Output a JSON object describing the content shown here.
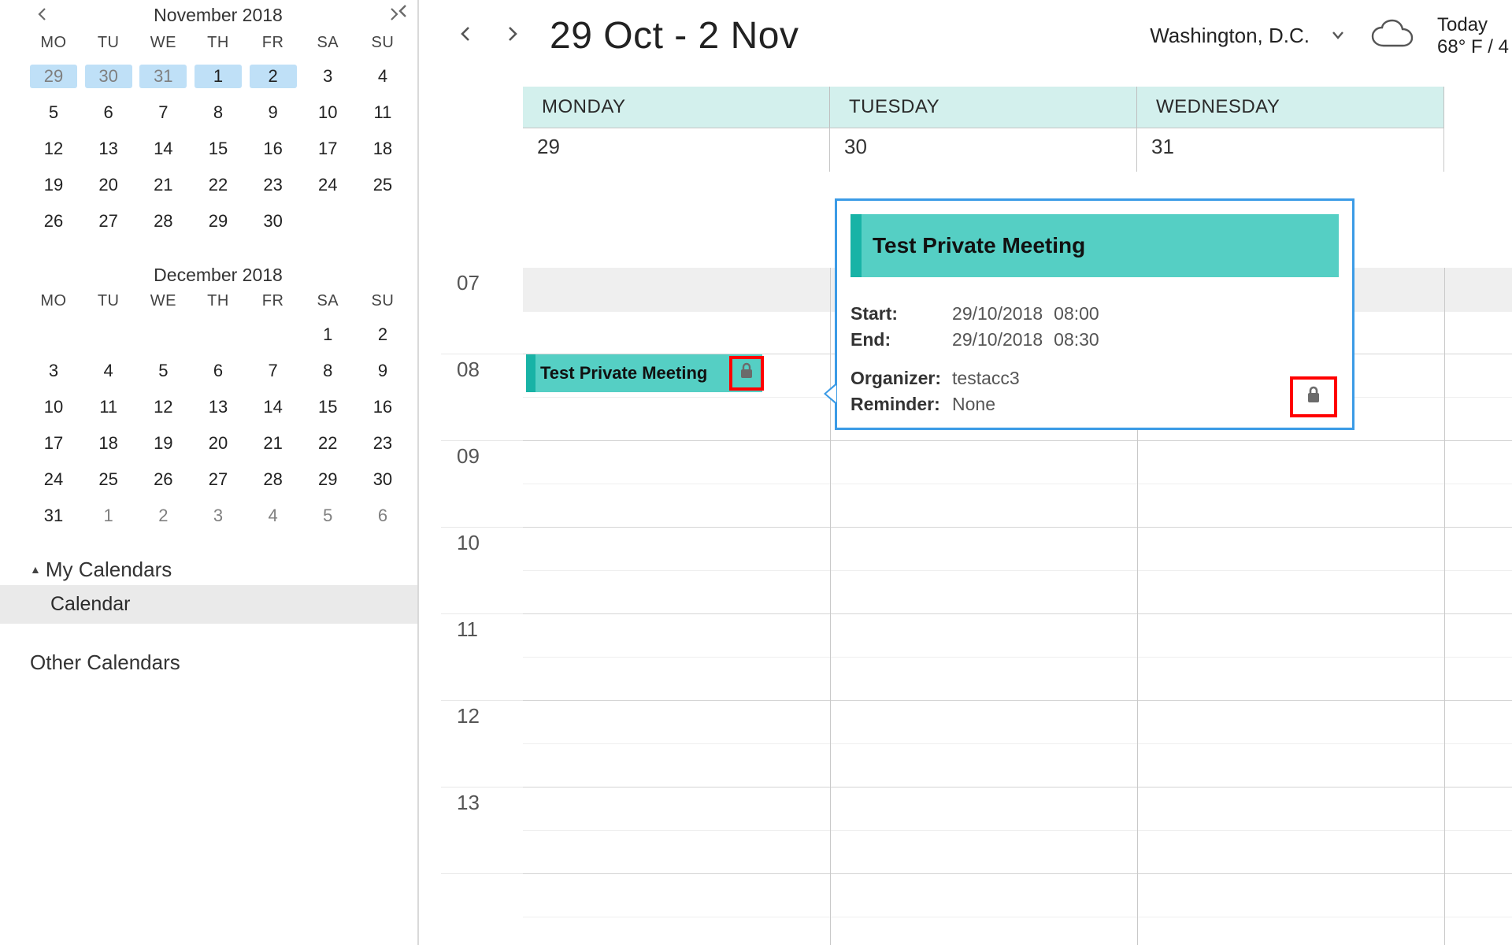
{
  "sidebar": {
    "month1": {
      "title": "November 2018",
      "dows": [
        "MO",
        "TU",
        "WE",
        "TH",
        "FR",
        "SA",
        "SU"
      ],
      "rows": [
        [
          {
            "n": "29",
            "sel": true,
            "dim": true
          },
          {
            "n": "30",
            "sel": true,
            "dim": true
          },
          {
            "n": "31",
            "sel": true,
            "dim": true
          },
          {
            "n": "1",
            "sel": true
          },
          {
            "n": "2",
            "sel": true
          },
          {
            "n": "3"
          },
          {
            "n": "4"
          }
        ],
        [
          {
            "n": "5"
          },
          {
            "n": "6"
          },
          {
            "n": "7"
          },
          {
            "n": "8"
          },
          {
            "n": "9"
          },
          {
            "n": "10"
          },
          {
            "n": "11"
          }
        ],
        [
          {
            "n": "12"
          },
          {
            "n": "13"
          },
          {
            "n": "14"
          },
          {
            "n": "15"
          },
          {
            "n": "16"
          },
          {
            "n": "17"
          },
          {
            "n": "18"
          }
        ],
        [
          {
            "n": "19"
          },
          {
            "n": "20"
          },
          {
            "n": "21"
          },
          {
            "n": "22"
          },
          {
            "n": "23"
          },
          {
            "n": "24"
          },
          {
            "n": "25"
          }
        ],
        [
          {
            "n": "26"
          },
          {
            "n": "27"
          },
          {
            "n": "28"
          },
          {
            "n": "29"
          },
          {
            "n": "30"
          },
          {
            "n": ""
          },
          {
            "n": ""
          }
        ]
      ]
    },
    "month2": {
      "title": "December 2018",
      "dows": [
        "MO",
        "TU",
        "WE",
        "TH",
        "FR",
        "SA",
        "SU"
      ],
      "rows": [
        [
          {
            "n": ""
          },
          {
            "n": ""
          },
          {
            "n": ""
          },
          {
            "n": ""
          },
          {
            "n": ""
          },
          {
            "n": "1"
          },
          {
            "n": "2"
          }
        ],
        [
          {
            "n": "3"
          },
          {
            "n": "4"
          },
          {
            "n": "5"
          },
          {
            "n": "6"
          },
          {
            "n": "7"
          },
          {
            "n": "8"
          },
          {
            "n": "9"
          }
        ],
        [
          {
            "n": "10"
          },
          {
            "n": "11"
          },
          {
            "n": "12"
          },
          {
            "n": "13"
          },
          {
            "n": "14"
          },
          {
            "n": "15"
          },
          {
            "n": "16"
          }
        ],
        [
          {
            "n": "17"
          },
          {
            "n": "18"
          },
          {
            "n": "19"
          },
          {
            "n": "20"
          },
          {
            "n": "21"
          },
          {
            "n": "22"
          },
          {
            "n": "23"
          }
        ],
        [
          {
            "n": "24"
          },
          {
            "n": "25"
          },
          {
            "n": "26"
          },
          {
            "n": "27"
          },
          {
            "n": "28"
          },
          {
            "n": "29"
          },
          {
            "n": "30"
          }
        ],
        [
          {
            "n": "31"
          },
          {
            "n": "1",
            "dim": true
          },
          {
            "n": "2",
            "dim": true
          },
          {
            "n": "3",
            "dim": true
          },
          {
            "n": "4",
            "dim": true
          },
          {
            "n": "5",
            "dim": true
          },
          {
            "n": "6",
            "dim": true
          }
        ]
      ]
    },
    "groups": {
      "my_calendars_label": "My Calendars",
      "calendar_item": "Calendar",
      "other_calendars_label": "Other Calendars"
    }
  },
  "header": {
    "range": "29 Oct - 2 Nov",
    "location": "Washington,  D.C.",
    "today_label": "Today",
    "today_temp": "68° F / 4"
  },
  "columns": {
    "days": [
      {
        "name": "MONDAY",
        "num": "29"
      },
      {
        "name": "TUESDAY",
        "num": "30"
      },
      {
        "name": "WEDNESDAY",
        "num": "31"
      }
    ]
  },
  "hours": [
    "07",
    "08",
    "09",
    "10",
    "11",
    "12",
    "13"
  ],
  "event": {
    "title": "Test Private Meeting"
  },
  "popup": {
    "title": "Test Private Meeting",
    "start_label": "Start:",
    "start_date": "29/10/2018",
    "start_time": "08:00",
    "end_label": "End:",
    "end_date": "29/10/2018",
    "end_time": "08:30",
    "organizer_label": "Organizer:",
    "organizer_value": "testacc3",
    "reminder_label": "Reminder:",
    "reminder_value": "None"
  }
}
